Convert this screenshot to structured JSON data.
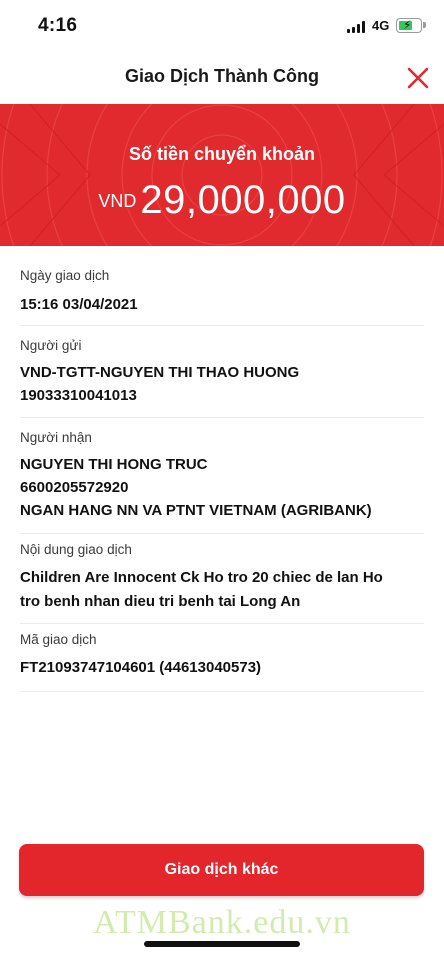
{
  "status_bar": {
    "time": "4:16",
    "network": "4G"
  },
  "header": {
    "title": "Giao Dịch Thành Công",
    "close_icon": "close-icon",
    "accent_color": "#e02a2e"
  },
  "banner": {
    "label": "Số tiền chuyển khoản",
    "currency": "VND",
    "amount": "29,000,000"
  },
  "details": {
    "date": {
      "label": "Ngày giao dịch",
      "value": "15:16 03/04/2021"
    },
    "sender": {
      "label": "Người gửi",
      "name": "VND-TGTT-NGUYEN THI THAO HUONG",
      "account": "19033310041013"
    },
    "recipient": {
      "label": "Người nhận",
      "name": "NGUYEN THI HONG TRUC",
      "account": "6600205572920",
      "bank": "NGAN HANG NN VA PTNT VIETNAM (AGRIBANK)"
    },
    "content": {
      "label": "Nội dung giao dịch",
      "line1": "Children Are Innocent Ck Ho tro 20 chiec de lan Ho",
      "line2": "tro benh nhan dieu tri benh tai Long An"
    },
    "transaction_id": {
      "label": "Mã giao dịch",
      "value": "FT21093747104601 (44613040573)"
    }
  },
  "action": {
    "button_label": "Giao dịch khác"
  },
  "watermark": "ATMBank.edu.vn"
}
